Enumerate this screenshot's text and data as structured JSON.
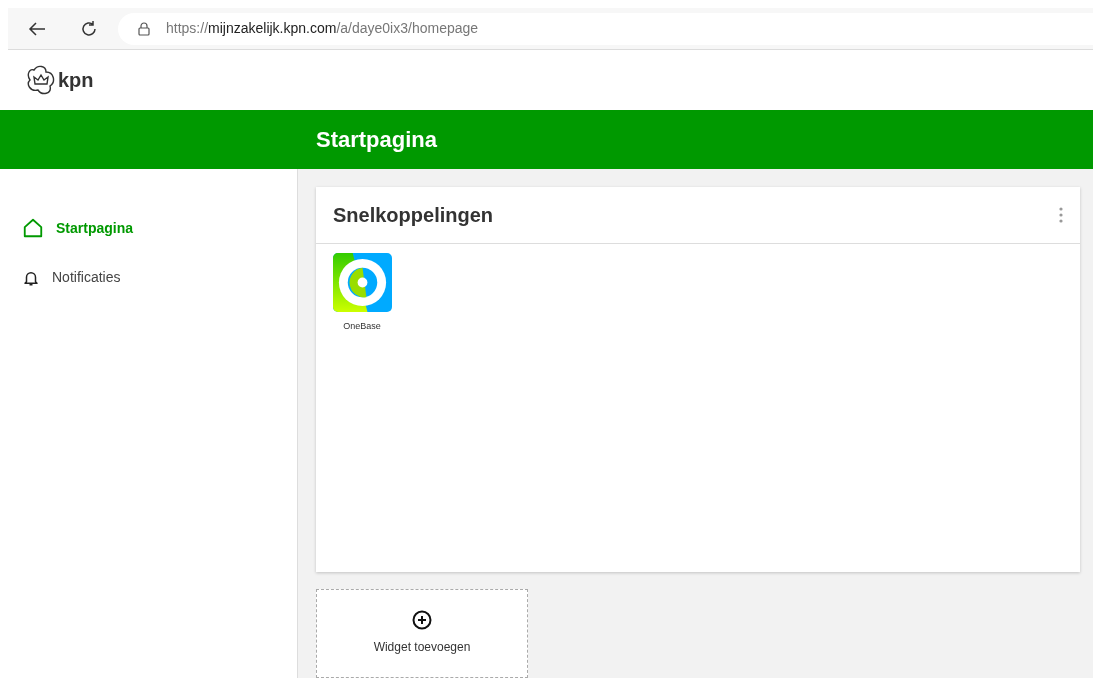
{
  "browser": {
    "url_scheme": "https://",
    "url_host": "mijnzakelijk.kpn.com",
    "url_path": "/a/daye0ix3/homepage"
  },
  "logo": {
    "text": "kpn"
  },
  "header": {
    "title": "Startpagina"
  },
  "sidebar": {
    "items": [
      {
        "label": "Startpagina",
        "kind": "home",
        "selected": true
      },
      {
        "label": "Notificaties",
        "kind": "bell",
        "selected": false
      }
    ]
  },
  "widget": {
    "title": "Snelkoppelingen",
    "shortcuts": [
      {
        "label": "OneBase"
      }
    ]
  },
  "add_widget": {
    "label": "Widget toevoegen"
  }
}
